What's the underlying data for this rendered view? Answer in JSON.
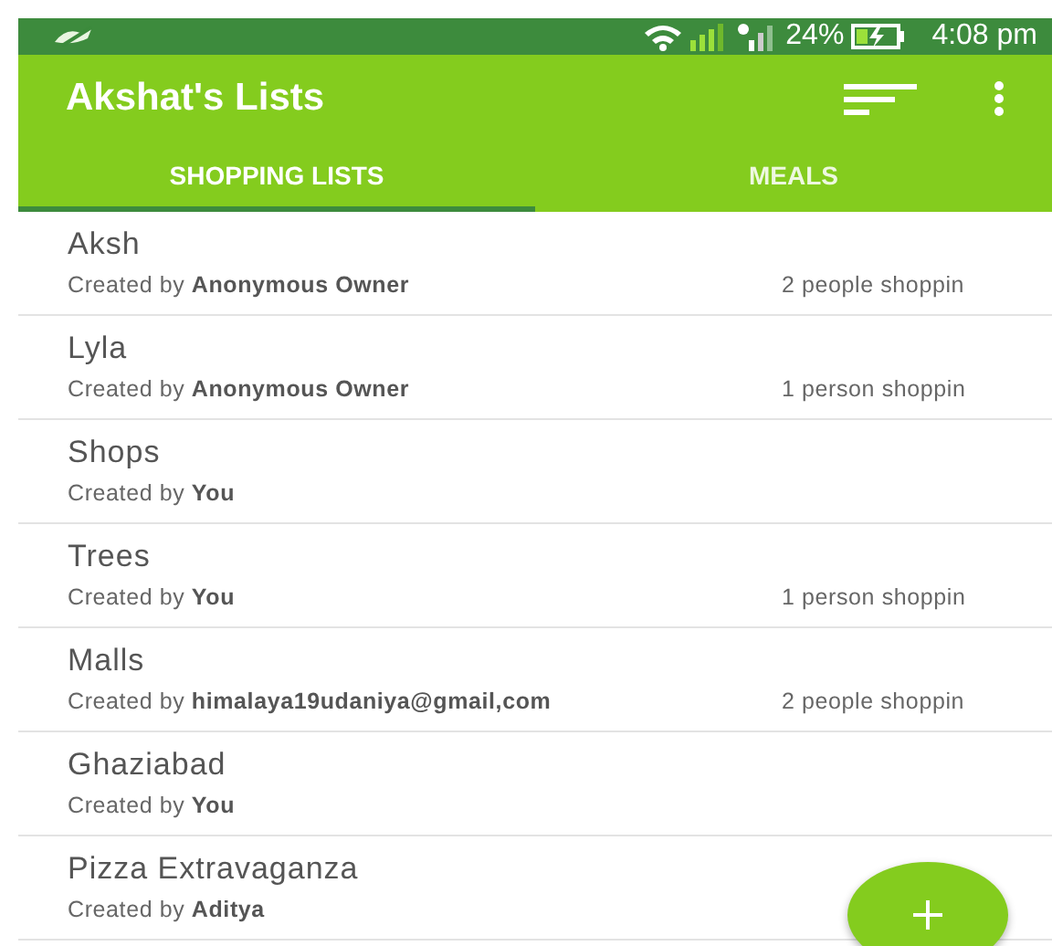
{
  "status_bar": {
    "battery": "24%",
    "time": "4:08 pm"
  },
  "toolbar": {
    "title": "Akshat's Lists"
  },
  "tabs": [
    {
      "label": "SHOPPING LISTS",
      "selected": true
    },
    {
      "label": "MEALS",
      "selected": false
    }
  ],
  "lists": [
    {
      "name": "Aksh",
      "created_by": "Created by **Anonymous Owner**",
      "shoppers": "2 people shoppin"
    },
    {
      "name": "Lyla",
      "created_by": "Created by **Anonymous Owner**",
      "shoppers": "1 person shoppin"
    },
    {
      "name": "Shops",
      "created_by": "Created by **You**"
    },
    {
      "name": "Trees",
      "created_by": "Created by **You**",
      "shoppers": "1 person shoppin"
    },
    {
      "name": "Malls",
      "created_by": "Created by **himalaya19udaniya@gmail,com**",
      "shoppers": "2 people shoppin"
    },
    {
      "name": "Ghaziabad",
      "created_by": "Created by **You**"
    },
    {
      "name": "Pizza Extravaganza",
      "created_by": "Created by **Aditya**"
    }
  ]
}
